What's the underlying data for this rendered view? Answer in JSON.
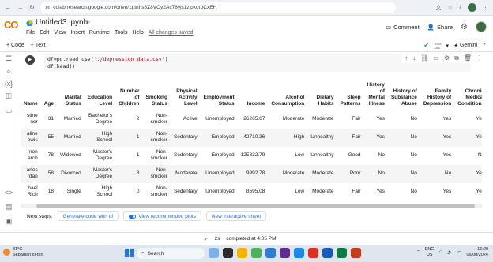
{
  "browser": {
    "url": "colab.research.google.com/drive/1ptnhs8Z8VOy2Ac78yjs1zlpkoroCxEH",
    "profile_color": "#3c6e47"
  },
  "header": {
    "logo": "CO",
    "title": "Untitled3.ipynb",
    "menu": [
      "File",
      "Edit",
      "View",
      "Insert",
      "Runtime",
      "Tools",
      "Help"
    ],
    "saved_status": "All changes saved",
    "comment_label": "Comment",
    "share_label": "Share"
  },
  "toolbar": {
    "code_label": "+ Code",
    "text_label": "+ Text",
    "ram_label": "RAM",
    "disk_label": "Disk",
    "gemini_label": "Gemini"
  },
  "cell": {
    "line1_prefix": "df=pd.read_csv(",
    "line1_string": "'./depression_data.csv'",
    "line1_suffix": ")",
    "line2": "df.head()"
  },
  "table": {
    "headers": [
      "Name",
      "Age",
      "Marital Status",
      "Education Level",
      "Number of Children",
      "Smoking Status",
      "Physical Activity Level",
      "Employment Status",
      "Income",
      "Alcohol Consumption",
      "Dietary Habits",
      "Sleep Patterns",
      "History of Mental Illness",
      "History of Substance Abuse",
      "Family History of Depression",
      "Chronic Medical Conditions"
    ],
    "rows": [
      [
        "stine ner",
        "31",
        "Married",
        "Bachelor's Degree",
        "2",
        "Non-smoker",
        "Active",
        "Unemployed",
        "26265.67",
        "Moderate",
        "Moderate",
        "Fair",
        "Yes",
        "No",
        "Yes",
        "Yes"
      ],
      [
        "aline ewis",
        "55",
        "Married",
        "High School",
        "1",
        "Non-smoker",
        "Sedentary",
        "Employed",
        "42710.36",
        "High",
        "Unhealthy",
        "Fair",
        "Yes",
        "No",
        "Yes",
        "Yes"
      ],
      [
        "non arch",
        "78",
        "Widowed",
        "Master's Degree",
        "1",
        "Non-smoker",
        "Sedentary",
        "Employed",
        "125332.79",
        "Low",
        "Unhealthy",
        "Good",
        "No",
        "No",
        "Yes",
        "No"
      ],
      [
        "arles rdan",
        "58",
        "Divorced",
        "Master's Degree",
        "3",
        "Non-smoker",
        "Moderate",
        "Unemployed",
        "9992.78",
        "Moderate",
        "Moderate",
        "Poor",
        "No",
        "No",
        "No",
        "Yes"
      ],
      [
        "hael Rich",
        "18",
        "Single",
        "High School",
        "0",
        "Non-smoker",
        "Sedentary",
        "Unemployed",
        "8595.08",
        "Low",
        "Moderate",
        "Fair",
        "Yes",
        "No",
        "Yes",
        "Yes"
      ]
    ]
  },
  "next_steps": {
    "label": "Next steps:",
    "generate": "Generate code with df",
    "plots": "View recommended plots",
    "sheet": "New interactive sheet"
  },
  "status": {
    "elapsed": "2s",
    "completed": "completed at 4:05 PM"
  },
  "taskbar": {
    "temp": "31°C",
    "weather": "Sebagian cerah",
    "search": "Search",
    "lang_top": "ENG",
    "lang_bottom": "US",
    "time": "16:29",
    "date": "06/08/2024"
  }
}
